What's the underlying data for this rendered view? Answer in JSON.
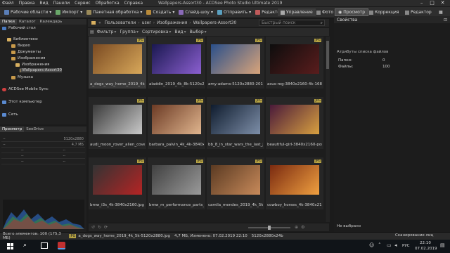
{
  "titlebar": {
    "menu": [
      "Файл",
      "Правка",
      "Вид",
      "Панели",
      "Сервис",
      "Обработка",
      "Справка"
    ],
    "title": "Wallpapers-Assort30 - ACDSee Photo Studio Ultimate 2019"
  },
  "toolbar": {
    "items": [
      "Рабочие области",
      "Импорт",
      "Пакетная обработка",
      "Создать",
      "Слайд-шоу",
      "Отправить",
      "Редакторы"
    ],
    "modes": [
      "Управление",
      "Фото",
      "Просмотр",
      "Коррекция",
      "Редактор"
    ],
    "active_mode": "Просмотр"
  },
  "left_panel": {
    "tabs": [
      "Папки",
      "Каталог",
      "Календарь"
    ],
    "tree": [
      "Рабочий стол",
      "Библиотеки",
      "Видео",
      "Документы",
      "Изображения",
      "Изображения",
      "Wallpapers-Assort30",
      "Музыка",
      "ACDSee Mobile Sync",
      "Этот компьютер",
      "Сеть"
    ]
  },
  "preview_panel": {
    "tabs": [
      "Просмотр",
      "SeeDrive"
    ],
    "info": [
      "--",
      "5120x2880",
      "--",
      "4,7 МБ",
      "--",
      "--",
      "--",
      "--",
      "--",
      "--"
    ]
  },
  "pathbar": {
    "segments": [
      "Пользователи",
      "user",
      "Изображения",
      "Wallpapers-Assort30"
    ],
    "search_placeholder": "Быстрый поиск"
  },
  "filterbar": {
    "items": [
      "Фильтр",
      "Группа",
      "Сортировка",
      "Вид",
      "Выбор"
    ]
  },
  "thumbnails": [
    {
      "name": "a_dogs_way_home_2019_4k_5...",
      "badge": "JPG",
      "c1": "#7a4a22",
      "c2": "#d8a85a"
    },
    {
      "name": "aladdin_2019_4k_8k-5120x2880...",
      "badge": "JPG",
      "c1": "#1a1850",
      "c2": "#8b5fd0"
    },
    {
      "name": "amy-adams-5120x2880-2016-...",
      "badge": "JPG",
      "c1": "#2a4f8a",
      "c2": "#d9a47a"
    },
    {
      "name": "asus-rog-3840x2160-4k-16814...",
      "badge": "JPG",
      "c1": "#0d0d0d",
      "c2": "#5a1d1d"
    },
    {
      "name": "audi_moon_rover_alien_cove...",
      "badge": "JPG",
      "c1": "#3a3a3a",
      "c2": "#c9c9c9"
    },
    {
      "name": "barbara_palvin_4k_4k-3840x2...",
      "badge": "JPG",
      "c1": "#6b3a24",
      "c2": "#e0b58e"
    },
    {
      "name": "bb_8_in_star_wars_the_last_je...",
      "badge": "JPG",
      "c1": "#0f1c2e",
      "c2": "#7d8ea8"
    },
    {
      "name": "beautiful-girl-3840x2160-port...",
      "badge": "JPG",
      "c1": "#4a1a3a",
      "c2": "#d8a040"
    },
    {
      "name": "bmw_i3s_4k-3840x2160.jpg",
      "badge": "JPG",
      "c1": "#333333",
      "c2": "#b52424"
    },
    {
      "name": "bmw_m_performance_parts_...",
      "badge": "JPG",
      "c1": "#404040",
      "c2": "#9a9a9a"
    },
    {
      "name": "camila_mendes_2019_4k_5k_...",
      "badge": "JPG",
      "c1": "#5a3a22",
      "c2": "#c88a5a"
    },
    {
      "name": "cowboy_horses_4k-3840x2160...",
      "badge": "JPG",
      "c1": "#7a2a10",
      "c2": "#f0a040"
    }
  ],
  "right_panel": {
    "title": "Свойства",
    "section": "Атрибуты списка файлов",
    "rows": [
      {
        "label": "Папки:",
        "value": "0"
      },
      {
        "label": "Файлы:",
        "value": "100"
      }
    ],
    "footer": "Не выбрано"
  },
  "statusbar": {
    "count": "Всего элементов: 100  (175,3 МБ)",
    "badge": "JPG",
    "file": "a_dogs_way_home_2019_4k_5k-5120x2880.jpg",
    "size": "4,7 МБ, Изменено: 07.02.2019 22:10",
    "dims": "5120x2880x24b",
    "scan": "Сканирование лиц"
  },
  "taskbar": {
    "lang": "РУС",
    "time": "22:10",
    "date": "07.02.2019"
  },
  "colors": {
    "accent": "#b8a443",
    "active_mode": "#4a4a4a"
  }
}
